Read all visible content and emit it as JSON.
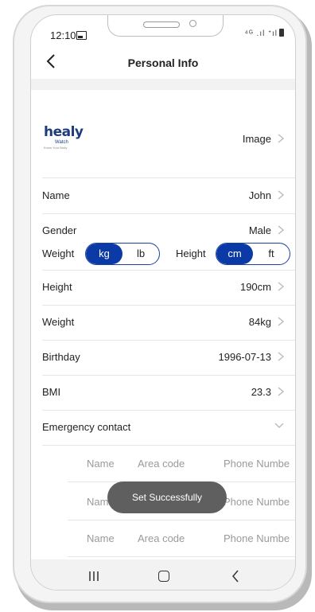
{
  "status_bar": {
    "time": "12:10",
    "signal_text": "⁴ᴳ .ıl ᐩıl"
  },
  "header": {
    "title": "Personal Info"
  },
  "logo": {
    "brand": "healy",
    "sub": "Watch",
    "tagline": "Know Your Body",
    "label": "Image"
  },
  "profile_rows": [
    {
      "label": "Name",
      "value": "John"
    },
    {
      "label": "Gender",
      "value": "Male"
    }
  ],
  "units": {
    "weight_label": "Weight",
    "weight_options": [
      "kg",
      "lb"
    ],
    "weight_selected": "kg",
    "height_label": "Height",
    "height_options": [
      "cm",
      "ft"
    ],
    "height_selected": "cm"
  },
  "measure_rows": [
    {
      "label": "Height",
      "value": "190cm"
    },
    {
      "label": "Weight",
      "value": "84kg"
    },
    {
      "label": "Birthday",
      "value": "1996-07-13"
    },
    {
      "label": "BMI",
      "value": "23.3"
    }
  ],
  "emergency": {
    "title": "Emergency contact",
    "columns": [
      "Name",
      "Area code",
      "Phone Numbe"
    ]
  },
  "toast": {
    "message": "Set Successfully"
  },
  "colors": {
    "accent": "#0b3aa6",
    "logo": "#1c3c7c",
    "placeholder": "#9a9a9a",
    "toast_bg": "#5f5f5f"
  }
}
